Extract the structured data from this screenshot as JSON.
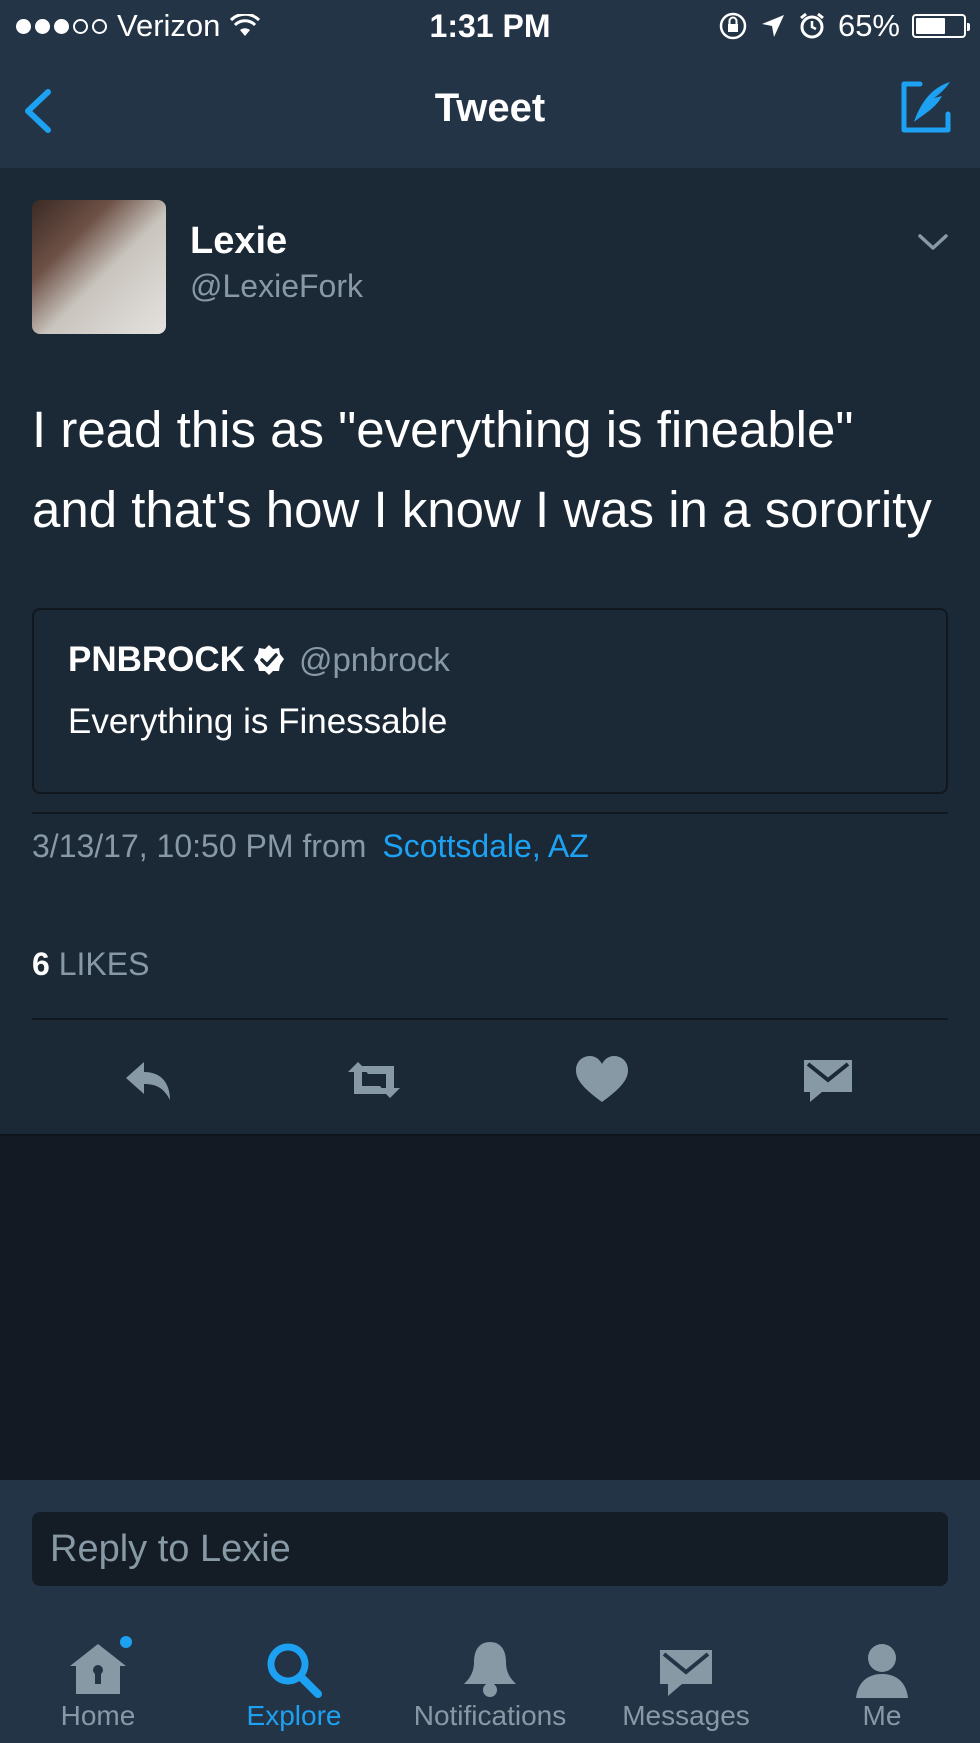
{
  "status_bar": {
    "carrier": "Verizon",
    "time": "1:31 PM",
    "battery": "65%",
    "battery_level": 0.65
  },
  "nav": {
    "title": "Tweet"
  },
  "tweet": {
    "author_name": "Lexie",
    "author_handle": "@LexieFork",
    "text": "I read this as \"everything is fineable\" and that's how I know I was in a sorority",
    "quoted": {
      "name": "PNBROCK",
      "handle": "@pnbrock",
      "text": "Everything is Finessable"
    },
    "timestamp": "3/13/17, 10:50 PM from",
    "location": "Scottsdale, AZ",
    "likes_count": "6",
    "likes_label": "LIKES"
  },
  "reply": {
    "placeholder": "Reply to Lexie"
  },
  "tabs": [
    {
      "label": "Home",
      "icon": "home-icon"
    },
    {
      "label": "Explore",
      "icon": "search-icon"
    },
    {
      "label": "Notifications",
      "icon": "bell-icon"
    },
    {
      "label": "Messages",
      "icon": "envelope-icon"
    },
    {
      "label": "Me",
      "icon": "person-icon"
    }
  ],
  "colors": {
    "accent": "#1da1f2",
    "background": "#1b2836",
    "bars": "#243447",
    "muted": "#8899a6"
  }
}
